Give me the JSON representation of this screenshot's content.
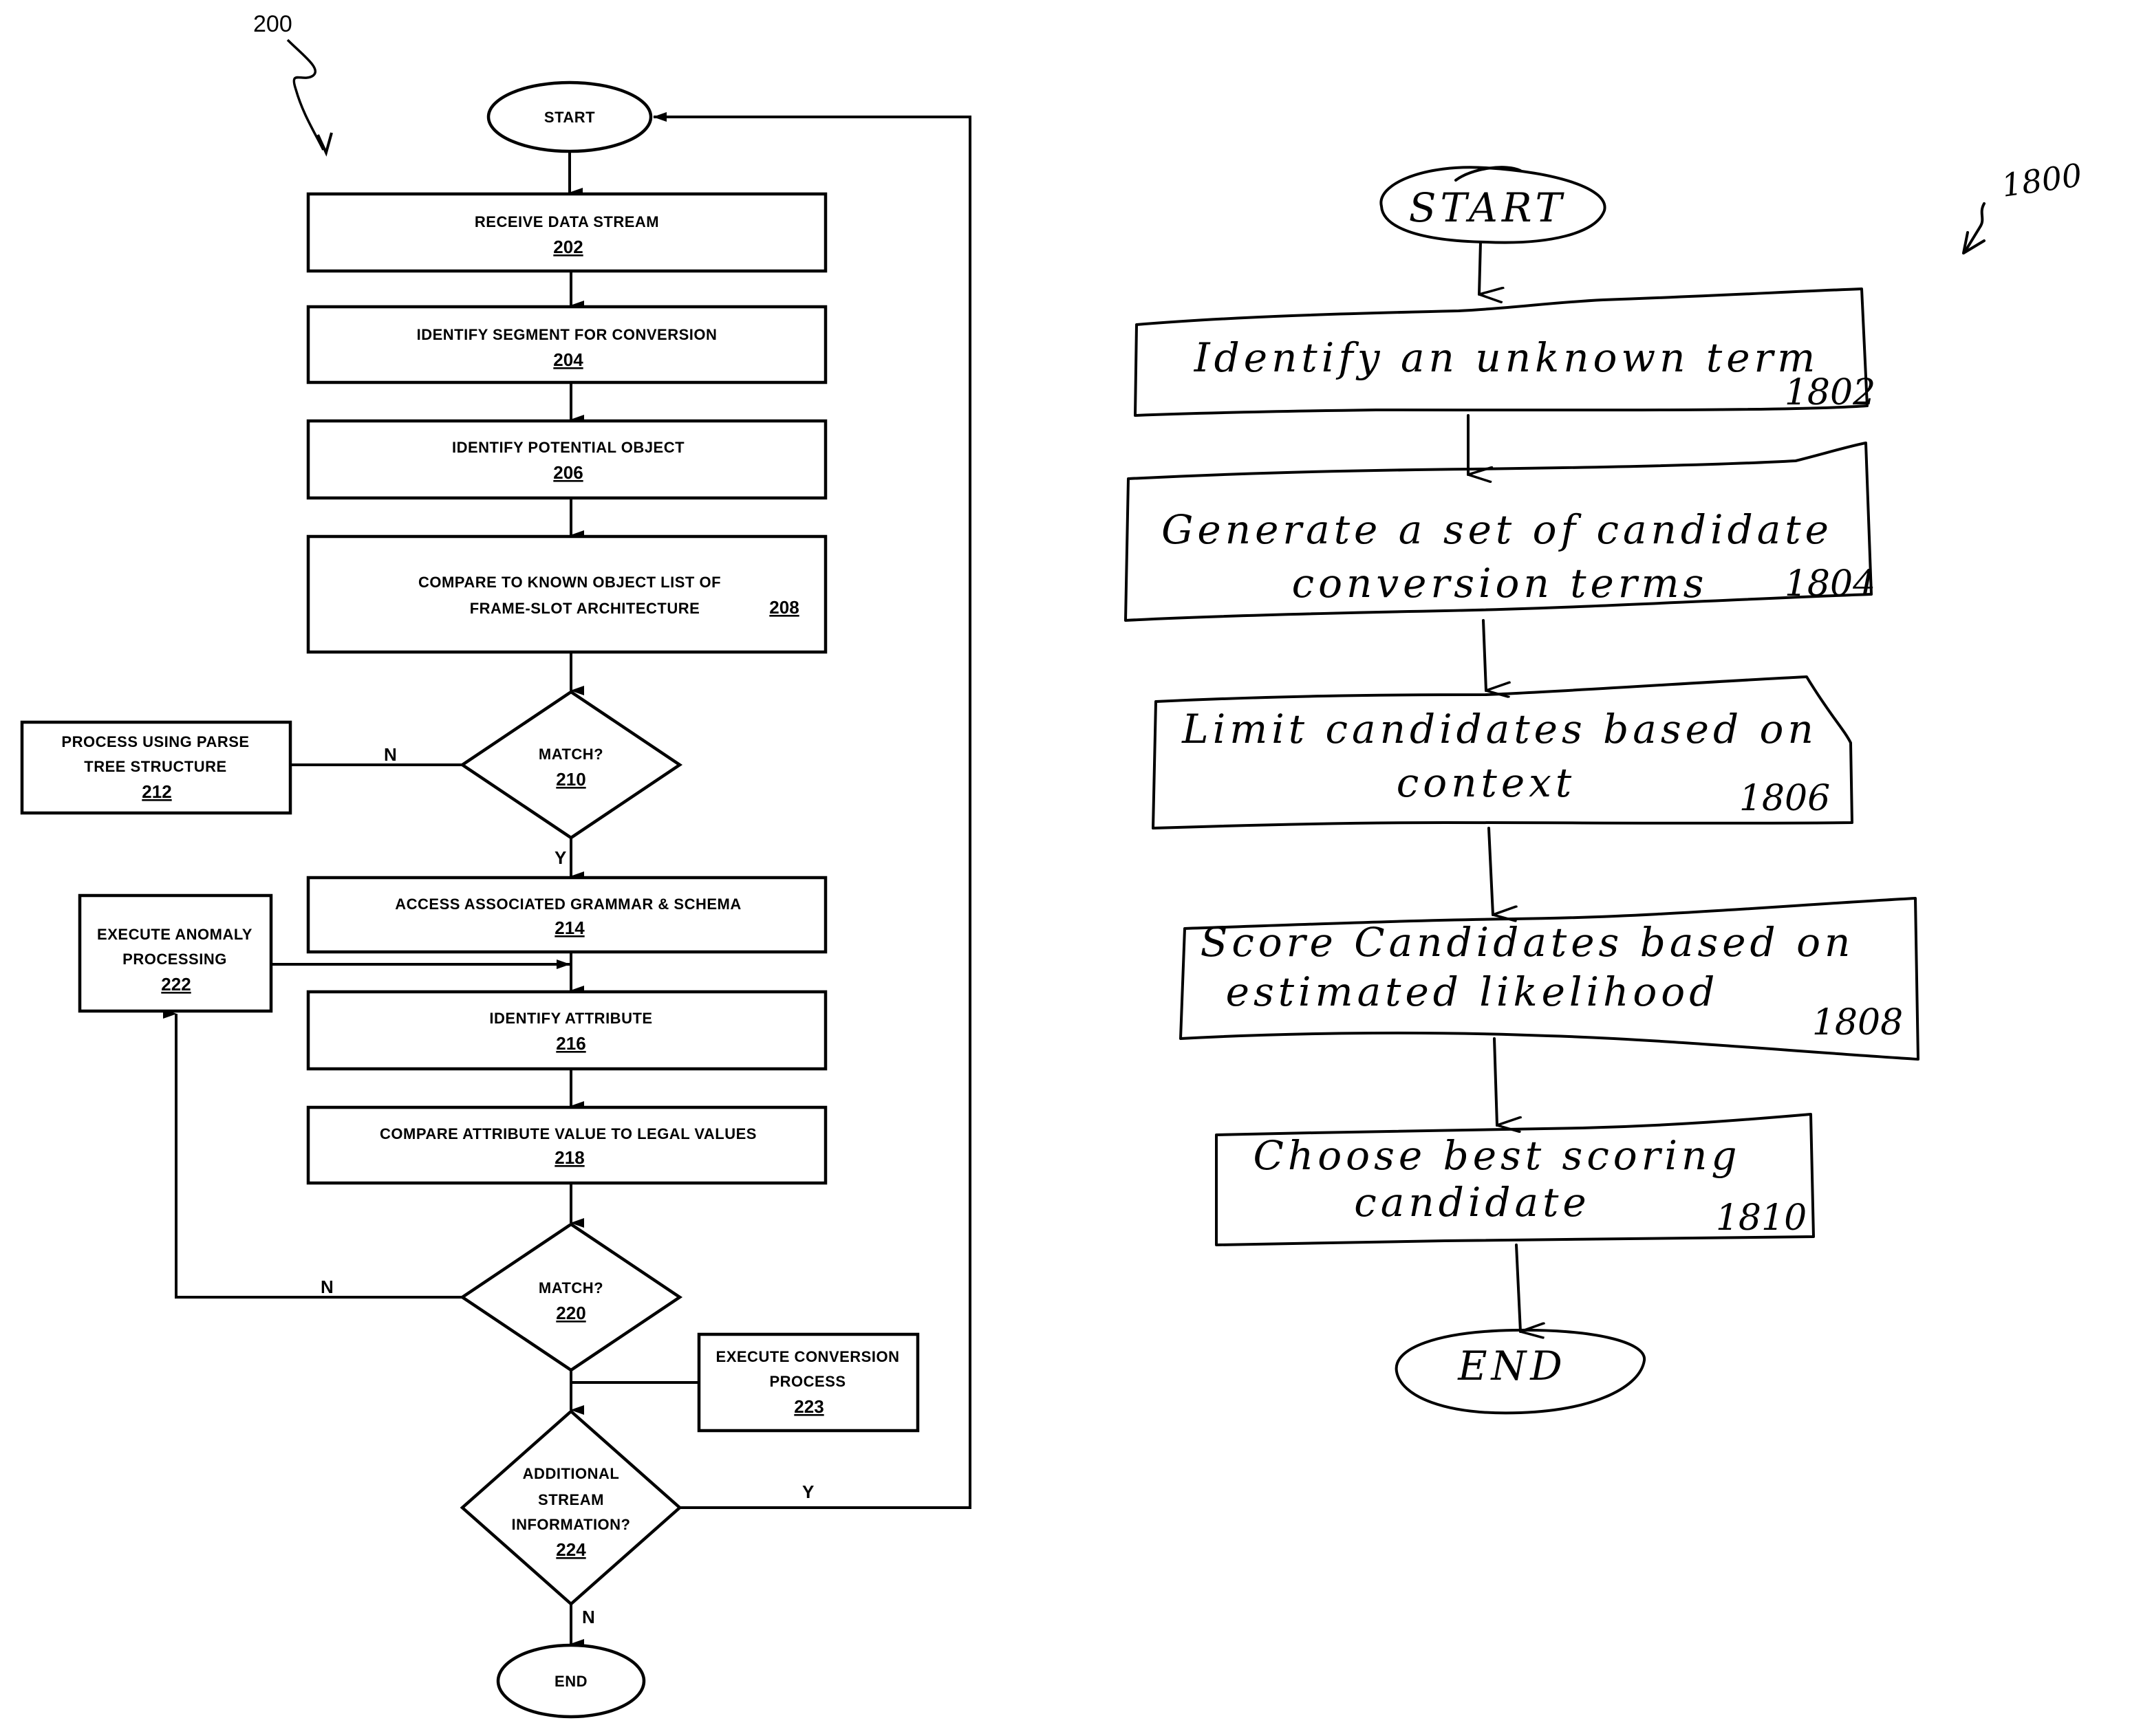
{
  "left_flowchart": {
    "figure_ref": "200",
    "start": "START",
    "end": "END",
    "steps": [
      {
        "id": "202",
        "lines": [
          "RECEIVE DATA STREAM"
        ]
      },
      {
        "id": "204",
        "lines": [
          "IDENTIFY SEGMENT FOR CONVERSION"
        ]
      },
      {
        "id": "206",
        "lines": [
          "IDENTIFY POTENTIAL OBJECT"
        ]
      },
      {
        "id": "208",
        "lines": [
          "COMPARE TO KNOWN OBJECT LIST OF",
          "FRAME-SLOT ARCHITECTURE"
        ]
      },
      {
        "id": "212",
        "lines": [
          "PROCESS USING PARSE",
          "TREE STRUCTURE"
        ]
      },
      {
        "id": "214",
        "lines": [
          "ACCESS ASSOCIATED GRAMMAR & SCHEMA"
        ]
      },
      {
        "id": "216",
        "lines": [
          "IDENTIFY ATTRIBUTE"
        ]
      },
      {
        "id": "218",
        "lines": [
          "COMPARE ATTRIBUTE VALUE TO LEGAL VALUES"
        ]
      },
      {
        "id": "222",
        "lines": [
          "EXECUTE ANOMALY",
          "PROCESSING"
        ]
      },
      {
        "id": "223",
        "lines": [
          "EXECUTE CONVERSION",
          "PROCESS"
        ]
      }
    ],
    "decisions": [
      {
        "id": "210",
        "lines": [
          "MATCH?"
        ],
        "no_label": "N",
        "yes_label": "Y"
      },
      {
        "id": "220",
        "lines": [
          "MATCH?"
        ],
        "no_label": "N"
      },
      {
        "id": "224",
        "lines": [
          "ADDITIONAL",
          "STREAM",
          "INFORMATION?"
        ],
        "yes_label": "Y",
        "no_label": "N"
      }
    ]
  },
  "right_flowchart": {
    "figure_ref": "1800",
    "start": "START",
    "end": "END",
    "steps": [
      {
        "id": "1802",
        "lines": [
          "Identify an unknown term"
        ]
      },
      {
        "id": "1804",
        "lines": [
          "Generate a set of candidate",
          "conversion terms"
        ]
      },
      {
        "id": "1806",
        "lines": [
          "Limit candidates based on",
          "context"
        ]
      },
      {
        "id": "1808",
        "lines": [
          "Score Candidates based on",
          "estimated likelihood"
        ]
      },
      {
        "id": "1810",
        "lines": [
          "Choose best scoring",
          "candidate"
        ]
      }
    ]
  }
}
